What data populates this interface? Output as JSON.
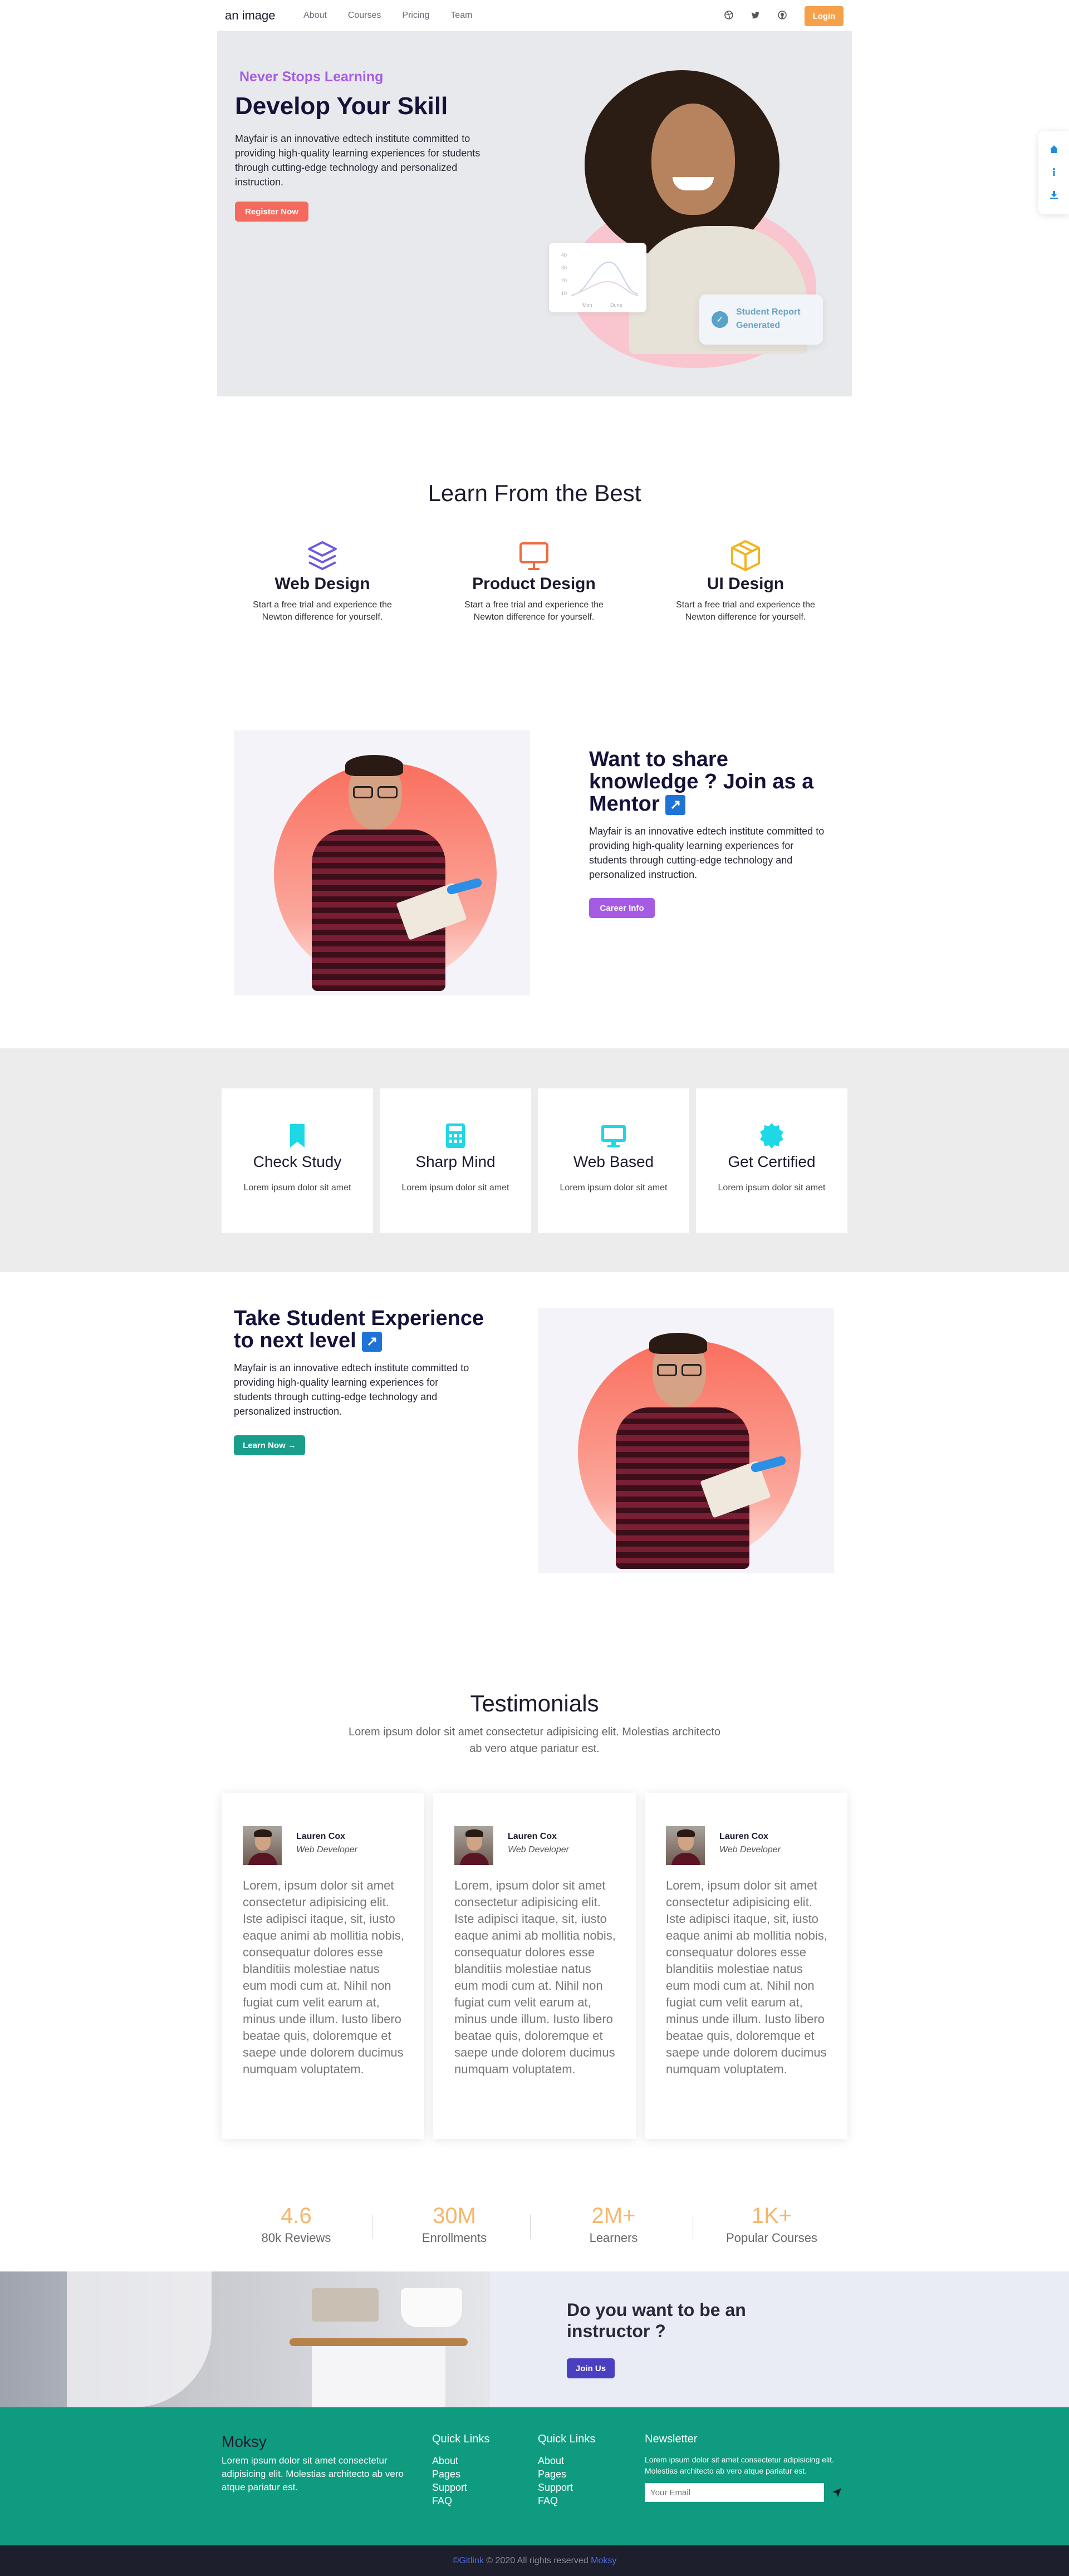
{
  "nav": {
    "logo_alt": "an image",
    "links": [
      "About",
      "Courses",
      "Pricing",
      "Team"
    ],
    "icons": [
      "dribbble-icon",
      "twitter-icon",
      "github-icon"
    ],
    "login": "Login"
  },
  "side_widget": {
    "icons": [
      "home-icon",
      "info-icon",
      "download-icon"
    ]
  },
  "hero": {
    "kicker": "Never Stops Learning",
    "title": "Develop Your Skill",
    "description": "Mayfair is an innovative edtech institute committed to providing high-quality learning experiences for students through cutting-edge technology and personalized instruction.",
    "cta": "Register Now",
    "chart_month_a": "Mon",
    "chart_month_b": "Dune",
    "chart_ticks": [
      "40",
      "30",
      "20",
      "10"
    ],
    "report_badge": "Student Report Generated"
  },
  "learn": {
    "title": "Learn From the Best",
    "items": [
      {
        "title": "Web Design",
        "desc": "Start a free trial and experience the Newton difference for yourself.",
        "icon": "layers-icon",
        "color": "#6b5ae0"
      },
      {
        "title": "Product Design",
        "desc": "Start a free trial and experience the Newton difference for yourself.",
        "icon": "monitor-icon",
        "color": "#f06a3b"
      },
      {
        "title": "UI Design",
        "desc": "Start a free trial and experience the Newton difference for yourself.",
        "icon": "package-icon",
        "color": "#f2b321"
      }
    ]
  },
  "mentor": {
    "title": "Want to share knowledge ? Join as a Mentor",
    "description": "Mayfair is an innovative edtech institute committed to providing high-quality learning experiences for students through cutting-edge technology and personalized instruction.",
    "cta": "Career Info"
  },
  "features": [
    {
      "title": "Check Study",
      "desc": "Lorem ipsum dolor sit amet",
      "icon": "bookmark-icon"
    },
    {
      "title": "Sharp Mind",
      "desc": "Lorem ipsum dolor sit amet",
      "icon": "calculator-icon"
    },
    {
      "title": "Web Based",
      "desc": "Lorem ipsum dolor sit amet",
      "icon": "desktop-icon"
    },
    {
      "title": "Get Certified",
      "desc": "Lorem ipsum dolor sit amet",
      "icon": "certificate-icon"
    }
  ],
  "experience": {
    "title": "Take Student Experience to next level",
    "description": "Mayfair is an innovative edtech institute committed to providing high-quality learning experiences for students through cutting-edge technology and personalized instruction.",
    "cta": "Learn Now →"
  },
  "testimonials": {
    "title": "Testimonials",
    "subtitle": "Lorem ipsum dolor sit amet consectetur adipisicing elit. Molestias architecto ab vero atque pariatur est.",
    "items": [
      {
        "name": "Lauren Cox",
        "role": "Web Developer",
        "quote": "Lorem, ipsum dolor sit amet consectetur adipisicing elit. Iste adipisci itaque, sit, iusto eaque animi ab mollitia nobis, consequatur dolores esse blanditiis molestiae natus eum modi cum at. Nihil non fugiat cum velit earum at, minus unde illum. Iusto libero beatae quis, doloremque et saepe unde dolorem ducimus numquam voluptatem."
      },
      {
        "name": "Lauren Cox",
        "role": "Web Developer",
        "quote": "Lorem, ipsum dolor sit amet consectetur adipisicing elit. Iste adipisci itaque, sit, iusto eaque animi ab mollitia nobis, consequatur dolores esse blanditiis molestiae natus eum modi cum at. Nihil non fugiat cum velit earum at, minus unde illum. Iusto libero beatae quis, doloremque et saepe unde dolorem ducimus numquam voluptatem."
      },
      {
        "name": "Lauren Cox",
        "role": "Web Developer",
        "quote": "Lorem, ipsum dolor sit amet consectetur adipisicing elit. Iste adipisci itaque, sit, iusto eaque animi ab mollitia nobis, consequatur dolores esse blanditiis molestiae natus eum modi cum at. Nihil non fugiat cum velit earum at, minus unde illum. Iusto libero beatae quis, doloremque et saepe unde dolorem ducimus numquam voluptatem."
      }
    ]
  },
  "stats": [
    {
      "value": "4.6",
      "label": "80k Reviews"
    },
    {
      "value": "30M",
      "label": "Enrollments"
    },
    {
      "value": "2M+",
      "label": "Learners"
    },
    {
      "value": "1K+",
      "label": "Popular Courses"
    }
  ],
  "instructor": {
    "title": "Do you want to be an instructor ?",
    "cta": "Join Us"
  },
  "footer": {
    "brand": "Moksy",
    "about": "Lorem ipsum dolor sit amet consectetur adipisicing elit. Molestias architecto ab vero atque pariatur est.",
    "col1_title": "Quick Links",
    "col1_links": [
      "About",
      "Pages",
      "Support",
      "FAQ"
    ],
    "col2_title": "Quick Links",
    "col2_links": [
      "About",
      "Pages",
      "Support",
      "FAQ"
    ],
    "newsletter_title": "Newsletter",
    "newsletter_text": "Lorem ipsum dolor sit amet consectetur adipisicing elit. Molestias architecto ab vero atque pariatur est.",
    "email_placeholder": "Your Email"
  },
  "copyright": {
    "left_link": "©Gitlink",
    "middle": " © 2020 All rights reserved ",
    "right_link": "Moksy"
  },
  "colors": {
    "accent_orange": "#f6a14a",
    "hero_kicker": "#a55be3",
    "register_btn": "#f46a5e",
    "career_btn": "#a55be3",
    "learn_btn": "#1a9e8c",
    "stat_value": "#f6b66a",
    "footer_bg": "#0f9b7f",
    "join_btn": "#4b3fc1",
    "feature_icon": "#1ed8e6"
  }
}
